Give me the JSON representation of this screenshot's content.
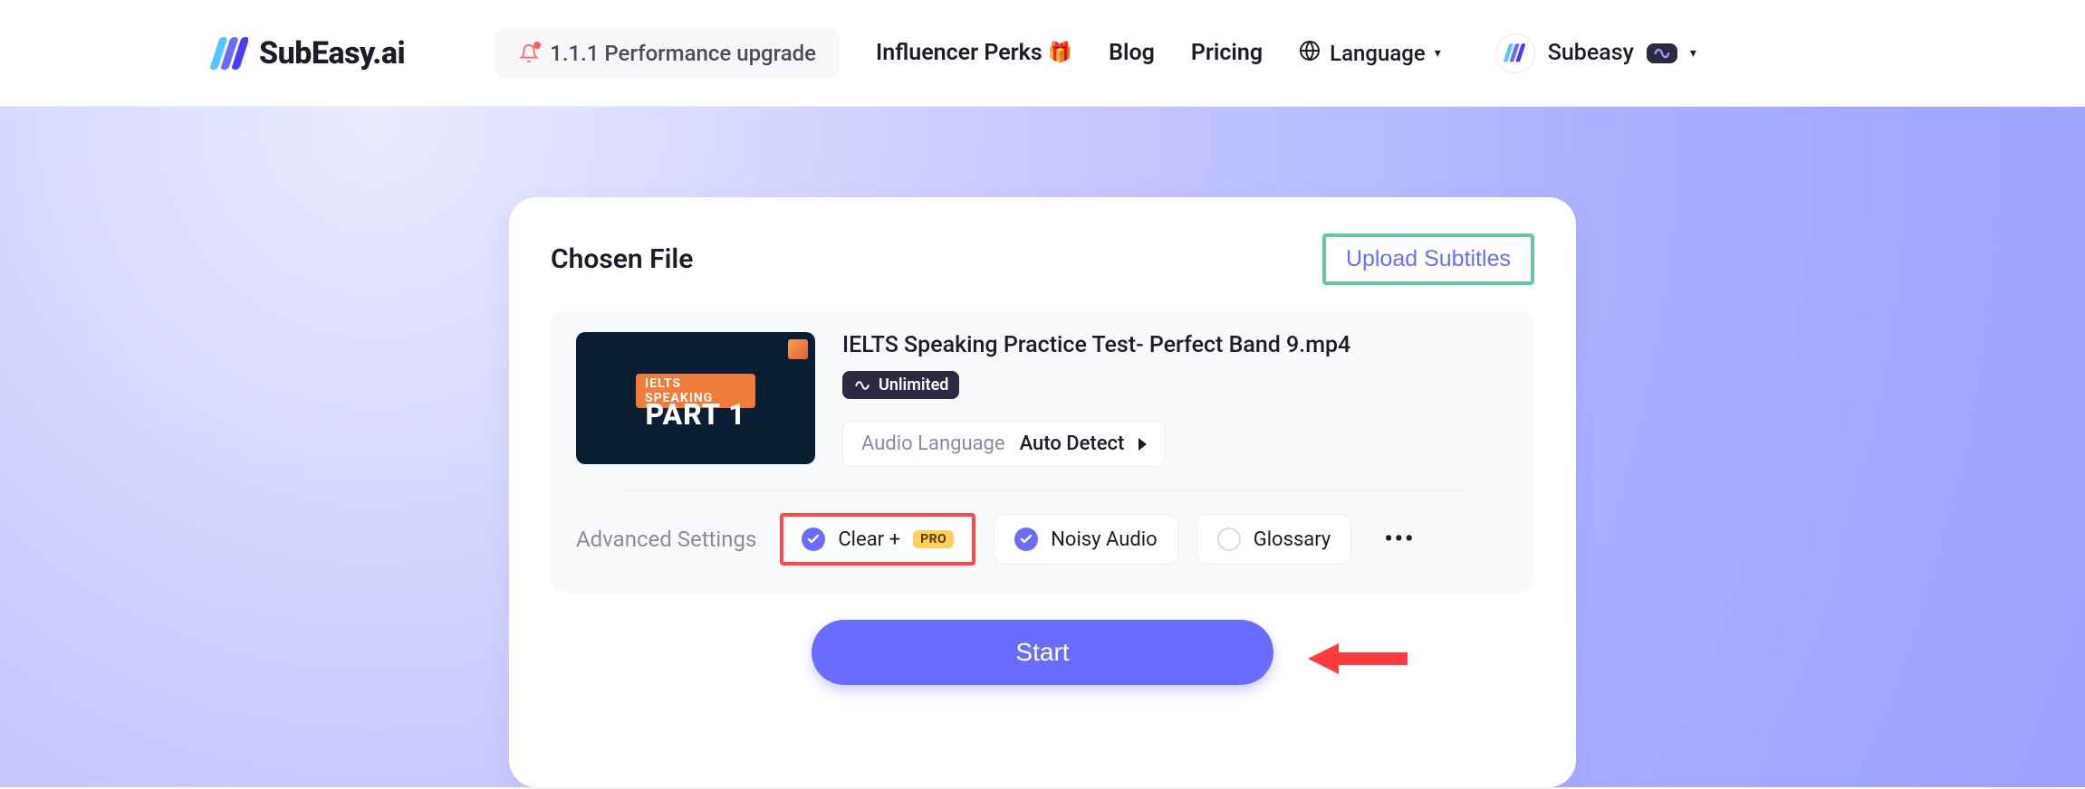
{
  "header": {
    "brand": "SubEasy.ai",
    "version_chip": "1.1.1 Performance upgrade",
    "nav": {
      "influencer": "Influencer Perks",
      "blog": "Blog",
      "pricing": "Pricing",
      "language": "Language"
    },
    "user": {
      "name": "Subeasy"
    }
  },
  "card": {
    "title": "Chosen File",
    "upload_subtitles": "Upload Subtitles",
    "file": {
      "thumb_tag": "IELTS SPEAKING",
      "thumb_part": "PART 1",
      "name": "IELTS Speaking Practice Test- Perfect Band 9.mp4",
      "unlimited": "Unlimited",
      "audio_lang_label": "Audio Language",
      "audio_lang_value": "Auto Detect"
    },
    "advanced": {
      "label": "Advanced Settings",
      "clear": "Clear +",
      "pro": "PRO",
      "noisy": "Noisy Audio",
      "glossary": "Glossary"
    },
    "start": "Start"
  }
}
